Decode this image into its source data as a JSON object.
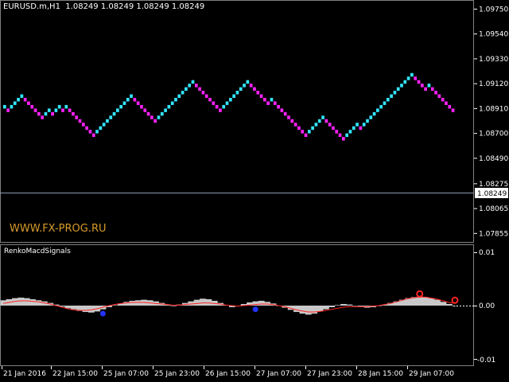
{
  "header": {
    "symbol": "EURUSD.m,H1",
    "ohlc": "1.08249 1.08249 1.08249 1.08249"
  },
  "price_axis": {
    "labels": [
      "1.09750",
      "1.09540",
      "1.09330",
      "1.09120",
      "1.08910",
      "1.08700",
      "1.08490",
      "1.08275",
      "1.08065",
      "1.07855"
    ],
    "current_price": "1.08249"
  },
  "watermark": "WWW.FX-PROG.RU",
  "indicator": {
    "name": "RenkoMacdSignals",
    "axis_labels": [
      "0.01",
      "0.00",
      "-0.01"
    ]
  },
  "time_axis": {
    "labels": [
      "21 Jan 2016",
      "22 Jan 15:00",
      "25 Jan 07:00",
      "25 Jan 23:00",
      "26 Jan 15:00",
      "27 Jan 07:00",
      "27 Jan 23:00",
      "28 Jan 15:00",
      "29 Jan 07:00"
    ]
  },
  "colors": {
    "background": "#000000",
    "up_brick": "#33e6ff",
    "down_brick": "#ff22ff",
    "histogram": "#c8c8c8",
    "signal_line": "#ff2222",
    "buy_marker": "#2233ff",
    "sell_marker": "#ff2222",
    "grid": "#808080",
    "watermark": "#d89a2a"
  },
  "chart_data": [
    {
      "type": "renko",
      "title": "EURUSD.m,H1",
      "ylim": [
        1.0779,
        1.098
      ],
      "brick_size": 0.0003,
      "start_low": 1.0888,
      "bricks": [
        "u",
        "d",
        "u",
        "u",
        "u",
        "u",
        "d",
        "d",
        "d",
        "d",
        "d",
        "d",
        "u",
        "u",
        "d",
        "u",
        "u",
        "d",
        "u",
        "d",
        "d",
        "d",
        "d",
        "d",
        "d",
        "d",
        "d",
        "u",
        "u",
        "u",
        "u",
        "u",
        "u",
        "u",
        "u",
        "u",
        "u",
        "u",
        "d",
        "d",
        "d",
        "d",
        "d",
        "d",
        "d",
        "u",
        "u",
        "u",
        "u",
        "u",
        "u",
        "u",
        "u",
        "u",
        "u",
        "u",
        "d",
        "d",
        "d",
        "d",
        "d",
        "d",
        "d",
        "d",
        "u",
        "u",
        "u",
        "u",
        "u",
        "u",
        "u",
        "u",
        "d",
        "d",
        "d",
        "d",
        "d",
        "d",
        "u",
        "d",
        "d",
        "d",
        "d",
        "d",
        "d",
        "d",
        "d",
        "d",
        "d",
        "u",
        "u",
        "u",
        "u",
        "u",
        "d",
        "d",
        "d",
        "d",
        "d",
        "d",
        "u",
        "u",
        "u",
        "u",
        "d",
        "u",
        "u",
        "u",
        "u",
        "u",
        "u",
        "u",
        "u",
        "u",
        "u",
        "u",
        "u",
        "u",
        "u",
        "u",
        "d",
        "d",
        "d",
        "d",
        "u",
        "d",
        "d",
        "d",
        "d",
        "d",
        "d",
        "d"
      ]
    },
    {
      "type": "area",
      "title": "RenkoMacdSignals",
      "ylim": [
        -0.01,
        0.01
      ],
      "series": [
        {
          "name": "",
          "values": [
            0.001,
            0.0012,
            0.0014,
            0.0015,
            0.0014,
            0.0012,
            0.001,
            0.0008,
            0.0005,
            0.0002,
            -0.0002,
            -0.0005,
            -0.0007,
            -0.001,
            -0.0012,
            -0.0013,
            -0.0011,
            -0.0007,
            -0.0003,
            0.0001,
            0.0004,
            0.0007,
            0.0009,
            0.001,
            0.0011,
            0.001,
            0.0008,
            0.0005,
            0.0002,
            -0.0001,
            0.0002,
            0.0005,
            0.0008,
            0.0011,
            0.0013,
            0.0012,
            0.0009,
            0.0005,
            0.0001,
            -0.0003,
            -0.0001,
            0.0003,
            0.0006,
            0.0008,
            0.0009,
            0.0007,
            0.0004,
            0.0,
            -0.0004,
            -0.0008,
            -0.0012,
            -0.0015,
            -0.0017,
            -0.0015,
            -0.0011,
            -0.0007,
            -0.0003,
            0.0001,
            0.0003,
            0.0002,
            0.0,
            -0.0002,
            -0.0004,
            -0.0003,
            -0.0001,
            0.0002,
            0.0005,
            0.0008,
            0.0011,
            0.0014,
            0.0016,
            0.0017,
            0.0016,
            0.0014,
            0.0011,
            0.0007,
            0.0003,
            0.0
          ]
        },
        {
          "name": "",
          "values": [
            0.0004,
            0.0006,
            0.0008,
            0.0009,
            0.0009,
            0.0008,
            0.0007,
            0.0005,
            0.0003,
            0.0,
            -0.0003,
            -0.0006,
            -0.0008,
            -0.0009,
            -0.0009,
            -0.0008,
            -0.0006,
            -0.0003,
            0.0,
            0.0002,
            0.0004,
            0.0005,
            0.0006,
            0.0006,
            0.0006,
            0.0005,
            0.0004,
            0.0003,
            0.0002,
            0.0001,
            0.0001,
            0.0002,
            0.0003,
            0.0004,
            0.0005,
            0.0005,
            0.0004,
            0.0003,
            0.0001,
            0.0,
            -0.0001,
            0.0,
            0.0001,
            0.0002,
            0.0003,
            0.0003,
            0.0002,
            0.0,
            -0.0002,
            -0.0005,
            -0.0008,
            -0.001,
            -0.0012,
            -0.0012,
            -0.0011,
            -0.0009,
            -0.0007,
            -0.0005,
            -0.0003,
            -0.0002,
            -0.0002,
            -0.0002,
            -0.0002,
            -0.0001,
            0.0,
            0.0002,
            0.0004,
            0.0007,
            0.001,
            0.0013,
            0.0015,
            0.0016,
            0.0016,
            0.0014,
            0.0012,
            0.0009,
            0.0006,
            0.0004
          ]
        }
      ],
      "buy_signals": [
        {
          "index": 17,
          "value": -0.0015
        },
        {
          "index": 43,
          "value": -0.0007
        }
      ],
      "sell_signals": [
        {
          "index": 71,
          "value": 0.0022
        },
        {
          "index": 77,
          "value": 0.001
        }
      ]
    }
  ]
}
